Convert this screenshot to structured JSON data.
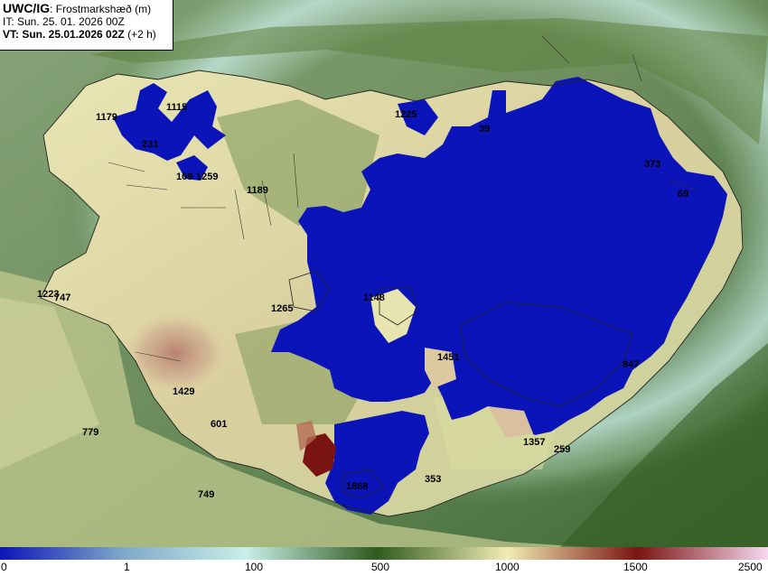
{
  "header": {
    "title_main": "UWC/IG",
    "title_rest": ": Frostmarkshæð (m)",
    "it_line": "IT: Sun. 25. 01. 2026 00Z",
    "vt_line": "VT: Sun. 25.01.2026 02Z",
    "vt_suffix": " (+2 h)"
  },
  "map": {
    "region": "Iceland",
    "variable": "freezing level height",
    "unit": "m",
    "colors": {
      "ocean_dark": "#4e6f3f",
      "ocean_light": "#a9c7b0",
      "land_low": "#e6e2a8",
      "land_mid": "#c9a890",
      "land_high": "#8a2b1f",
      "below_zero": "#0a14b8"
    },
    "labels": [
      {
        "id": "l1179",
        "text": "1179"
      },
      {
        "id": "l1115",
        "text": "1115"
      },
      {
        "id": "l231",
        "text": "231"
      },
      {
        "id": "l109",
        "text": "109"
      },
      {
        "id": "l1259",
        "text": "1259"
      },
      {
        "id": "l1189",
        "text": "1189"
      },
      {
        "id": "l1225",
        "text": "1225"
      },
      {
        "id": "l39",
        "text": "39"
      },
      {
        "id": "l373",
        "text": "373"
      },
      {
        "id": "l69",
        "text": "69"
      },
      {
        "id": "l1223",
        "text": "1223"
      },
      {
        "id": "l747",
        "text": "747"
      },
      {
        "id": "l1148",
        "text": "1148"
      },
      {
        "id": "l1265",
        "text": "1265"
      },
      {
        "id": "l1451",
        "text": "1451"
      },
      {
        "id": "l847",
        "text": "847"
      },
      {
        "id": "l1429",
        "text": "1429"
      },
      {
        "id": "l601",
        "text": "601"
      },
      {
        "id": "l779",
        "text": "779"
      },
      {
        "id": "l1357",
        "text": "1357"
      },
      {
        "id": "l259",
        "text": "259"
      },
      {
        "id": "l353",
        "text": "353"
      },
      {
        "id": "l1868",
        "text": "1868"
      },
      {
        "id": "l749",
        "text": "749"
      }
    ]
  },
  "colorbar": {
    "ticks": [
      "0",
      "1",
      "100",
      "500",
      "1000",
      "1500",
      "2500"
    ],
    "stops": [
      "#0a14b8",
      "#7fa8c9",
      "#c8efe8",
      "#2f5a1e",
      "#f1ecb4",
      "#7a1410",
      "#f7d8f0"
    ]
  }
}
